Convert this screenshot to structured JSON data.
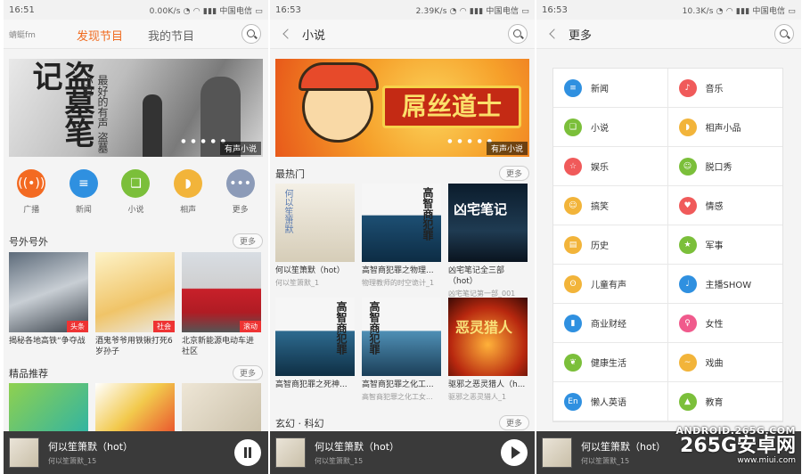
{
  "panel1": {
    "status": {
      "time": "16:51",
      "right": "0.00K/s  ◔ ◠ ▮▮▮ 中国电信 ▭"
    },
    "logo": "蜻蜓fm",
    "tabs": [
      "发现节目",
      "我的节目"
    ],
    "banner": {
      "big": "盗墓笔记",
      "small": "最好的有声 盗墓小说",
      "tag": "有声小说",
      "dots": "● ● ● ● ●"
    },
    "categories": [
      {
        "label": "广播",
        "icon": "radio-tower-icon",
        "color": "#f36a22",
        "glyph": "((•))"
      },
      {
        "label": "新闻",
        "icon": "news-icon",
        "color": "#2f90e0",
        "glyph": "≡"
      },
      {
        "label": "小说",
        "icon": "book-icon",
        "color": "#7bbf3a",
        "glyph": "❑"
      },
      {
        "label": "相声",
        "icon": "fan-icon",
        "color": "#f2b43a",
        "glyph": "◗"
      },
      {
        "label": "更多",
        "icon": "more-icon",
        "color": "#8c9bb8",
        "glyph": "•••"
      }
    ],
    "section1": {
      "title": "号外号外",
      "more": "更多"
    },
    "news": [
      {
        "caption": "揭秘各地高铁“争夺战",
        "tag": "头条"
      },
      {
        "caption": "酒鬼爷爷用铁锹打死6岁孙子",
        "tag": "社会"
      },
      {
        "caption": "北京新能源电动车进社区",
        "tag": "滚动"
      }
    ],
    "section2": {
      "title": "精品推荐",
      "more": "更多"
    },
    "player": {
      "title": "何以笙箫默（hot）",
      "sub": "何以笙箫默_15"
    }
  },
  "panel2": {
    "status": {
      "time": "16:53",
      "right": "2.39K/s  ◔ ◠ ▮▮▮ 中国电信 ▭"
    },
    "title": "小说",
    "banner": {
      "text": "屌丝道士",
      "tag": "有声小说",
      "dots": "● ● ● ● ●"
    },
    "section1": {
      "title": "最热门",
      "more": "更多"
    },
    "books_row1": [
      {
        "caption": "何以笙箫默（hot）",
        "sub": "何以笙箫默_1",
        "cover_text": "何以笙箫默"
      },
      {
        "caption": "高智商犯罪之物理...",
        "sub": "物理教师的时空诡计_1",
        "cover_text": "高智商犯罪"
      },
      {
        "caption": "凶宅笔记全三部（hot）",
        "sub": "凶宅笔记第一部_001",
        "cover_text": "凶宅笔记"
      }
    ],
    "books_row2": [
      {
        "caption": "高智商犯罪之死神...",
        "sub": "",
        "cover_text": "高智商犯罪"
      },
      {
        "caption": "高智商犯罪之化工...",
        "sub": "高智商犯罪之化工女...",
        "cover_text": "高智商犯罪"
      },
      {
        "caption": "驱邪之恶灵猎人（h...",
        "sub": "驱邪之恶灵猎人_1",
        "cover_text": "恶灵猎人"
      }
    ],
    "section2": {
      "title": "玄幻 · 科幻",
      "more": "更多"
    },
    "player": {
      "title": "何以笙箫默（hot）",
      "sub": "何以笙箫默_15"
    }
  },
  "panel3": {
    "status": {
      "time": "16:53",
      "right": "10.3K/s  ◔ ◠ ▮▮▮ 中国电信 ▭"
    },
    "title": "更多",
    "items": [
      {
        "label": "新闻",
        "icon": "news-icon",
        "color": "#2f90e0",
        "glyph": "≡"
      },
      {
        "label": "音乐",
        "icon": "music-icon",
        "color": "#f05a5a",
        "glyph": "♪"
      },
      {
        "label": "小说",
        "icon": "book-icon",
        "color": "#7bbf3a",
        "glyph": "❑"
      },
      {
        "label": "相声小品",
        "icon": "fan-icon",
        "color": "#f2b43a",
        "glyph": "◗"
      },
      {
        "label": "娱乐",
        "icon": "star-icon",
        "color": "#f05a5a",
        "glyph": "☆"
      },
      {
        "label": "脱口秀",
        "icon": "mouth-icon",
        "color": "#7bbf3a",
        "glyph": "☺"
      },
      {
        "label": "搞笑",
        "icon": "smile-icon",
        "color": "#f2b43a",
        "glyph": "☺"
      },
      {
        "label": "情感",
        "icon": "heart-icon",
        "color": "#f05a5a",
        "glyph": "♥"
      },
      {
        "label": "历史",
        "icon": "scroll-icon",
        "color": "#f2b43a",
        "glyph": "▤"
      },
      {
        "label": "军事",
        "icon": "military-star-icon",
        "color": "#7bbf3a",
        "glyph": "★"
      },
      {
        "label": "儿童有声",
        "icon": "bear-icon",
        "color": "#f2b43a",
        "glyph": "ʘ"
      },
      {
        "label": "主播SHOW",
        "icon": "microphone-icon",
        "color": "#2f90e0",
        "glyph": "♩"
      },
      {
        "label": "商业财经",
        "icon": "bar-chart-icon",
        "color": "#2f90e0",
        "glyph": "▮"
      },
      {
        "label": "女性",
        "icon": "female-icon",
        "color": "#f05a8c",
        "glyph": "♀"
      },
      {
        "label": "健康生活",
        "icon": "leaf-icon",
        "color": "#7bbf3a",
        "glyph": "❦"
      },
      {
        "label": "戏曲",
        "icon": "mustache-icon",
        "color": "#f2b43a",
        "glyph": "~"
      },
      {
        "label": "懒人英语",
        "icon": "english-icon",
        "color": "#2f90e0",
        "glyph": "En"
      },
      {
        "label": "教育",
        "icon": "graduation-cap-icon",
        "color": "#7bbf3a",
        "glyph": "▲"
      }
    ],
    "player": {
      "title": "何以笙箫默（hot）",
      "sub": "何以笙箫默_15"
    }
  },
  "watermark": {
    "line1": "ANDROID.265G.COM",
    "line2": "265G安卓网",
    "line3": "www.miui.com"
  }
}
